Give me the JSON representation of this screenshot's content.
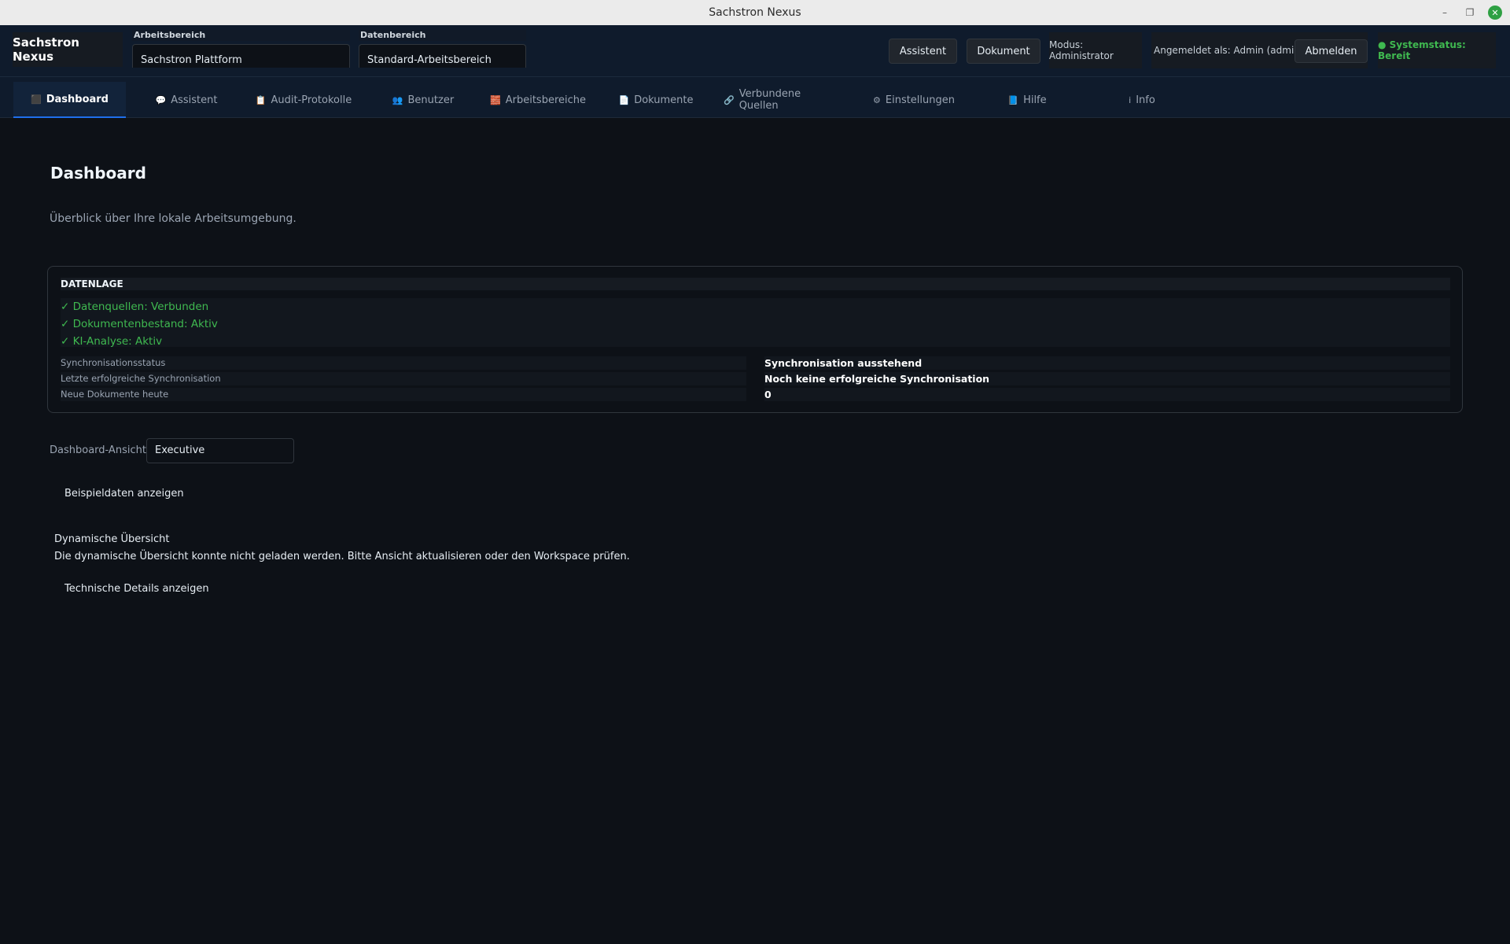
{
  "window": {
    "title": "Sachstron Nexus",
    "controls": {
      "minimize": "–",
      "restore": "❐",
      "close": "✕"
    }
  },
  "header": {
    "brand": "Sachstron Nexus",
    "workspace": {
      "label": "Arbeitsbereich",
      "value": "Sachstron Plattform"
    },
    "datarange": {
      "label": "Datenbereich",
      "value": "Standard-Arbeitsbereich"
    },
    "assistant_button": "Assistent",
    "document_button": "Dokument",
    "mode": "Modus: Administrator",
    "logged_in": "Angemeldet als: Admin (admin)",
    "logout_button": "Abmelden",
    "system_status": "● Systemstatus: Bereit"
  },
  "tabs": [
    {
      "icon": "⬛",
      "label": "Dashboard"
    },
    {
      "icon": "💬",
      "label": "Assistent"
    },
    {
      "icon": "📋",
      "label": "Audit-Protokolle"
    },
    {
      "icon": "👥",
      "label": "Benutzer"
    },
    {
      "icon": "🧱",
      "label": "Arbeitsbereiche"
    },
    {
      "icon": "📄",
      "label": "Dokumente"
    },
    {
      "icon": "🔗",
      "label": "Verbundene Quellen"
    },
    {
      "icon": "⚙",
      "label": "Einstellungen"
    },
    {
      "icon": "📘",
      "label": "Hilfe"
    },
    {
      "icon": "i",
      "label": "Info"
    }
  ],
  "main": {
    "title": "Dashboard",
    "subtitle": "Überblick über Ihre lokale Arbeitsumgebung.",
    "datenlage": {
      "heading": "DATENLAGE",
      "checks": [
        "✓ Datenquellen: Verbunden",
        "✓ Dokumentenbestand: Aktiv",
        "✓ KI-Analyse: Aktiv"
      ],
      "rows": [
        {
          "key": "Synchronisationsstatus",
          "value": "Synchronisation ausstehend"
        },
        {
          "key": "Letzte erfolgreiche Synchronisation",
          "value": "Noch keine erfolgreiche Synchronisation"
        },
        {
          "key": "Neue Dokumente heute",
          "value": "0"
        }
      ]
    },
    "view": {
      "label": "Dashboard-Ansicht",
      "value": "Executive"
    },
    "sample_button": "Beispieldaten anzeigen",
    "dynamic": {
      "title": "Dynamische Übersicht",
      "text": "Die dynamische Übersicht konnte nicht geladen werden. Bitte Ansicht aktualisieren oder den Workspace prüfen.",
      "details_button": "Technische Details anzeigen"
    }
  },
  "colors": {
    "accent_green": "#3fb950",
    "background": "#0d1117",
    "header": "#0f1b2c"
  }
}
